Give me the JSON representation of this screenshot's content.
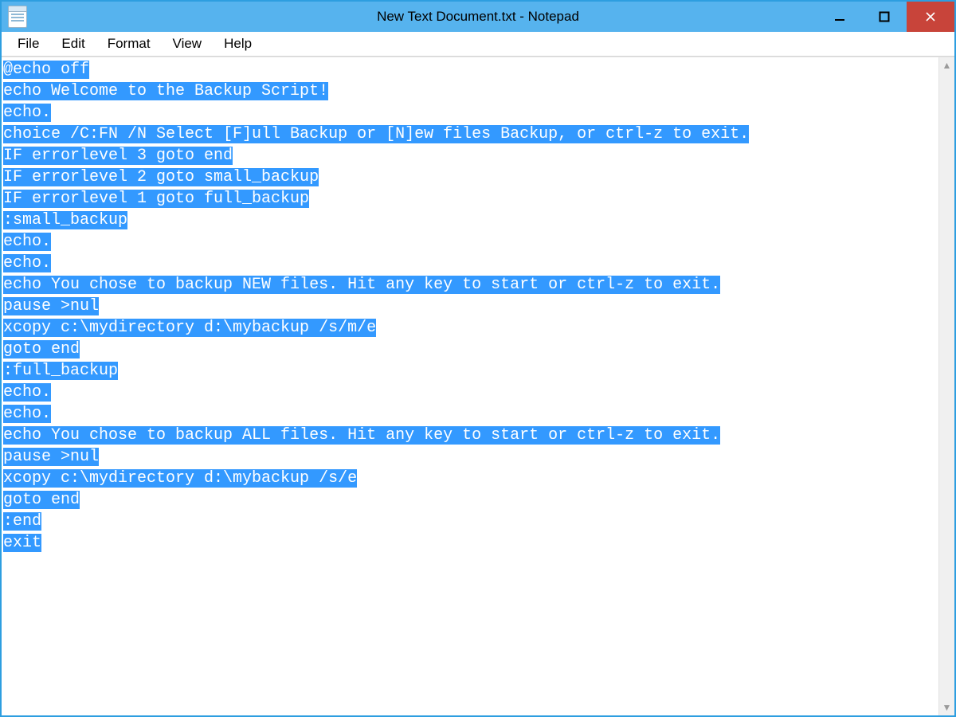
{
  "window": {
    "title": "New Text Document.txt - Notepad"
  },
  "menu": {
    "items": [
      {
        "label": "File"
      },
      {
        "label": "Edit"
      },
      {
        "label": "Format"
      },
      {
        "label": "View"
      },
      {
        "label": "Help"
      }
    ]
  },
  "editor": {
    "lines": [
      "@echo off",
      "echo Welcome to the Backup Script!",
      "echo.",
      "choice /C:FN /N Select [F]ull Backup or [N]ew files Backup, or ctrl-z to exit.",
      "IF errorlevel 3 goto end",
      "IF errorlevel 2 goto small_backup",
      "IF errorlevel 1 goto full_backup",
      ":small_backup",
      "echo.",
      "echo.",
      "echo You chose to backup NEW files. Hit any key to start or ctrl-z to exit.",
      "pause >nul",
      "xcopy c:\\mydirectory d:\\mybackup /s/m/e",
      "goto end",
      ":full_backup",
      "echo.",
      "echo.",
      "echo You chose to backup ALL files. Hit any key to start or ctrl-z to exit.",
      "pause >nul",
      "xcopy c:\\mydirectory d:\\mybackup /s/e",
      "goto end",
      ":end",
      "exit"
    ],
    "selection_highlight": true
  },
  "colors": {
    "titlebar": "#56b3ee",
    "border": "#2d9ee0",
    "selection_bg": "#3399ff",
    "selection_fg": "#ffffff",
    "close_btn": "#c8443a"
  }
}
